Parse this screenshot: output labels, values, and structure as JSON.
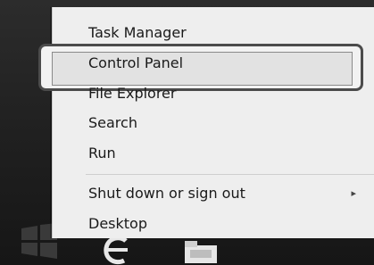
{
  "menu": {
    "items": [
      {
        "label": "Task Manager"
      },
      {
        "label": "Control Panel"
      },
      {
        "label": "File Explorer"
      },
      {
        "label": "Search"
      },
      {
        "label": "Run"
      },
      {
        "label": "Shut down or sign out"
      },
      {
        "label": "Desktop"
      }
    ],
    "submenu_arrow": "▸",
    "highlighted_item": "Control Panel"
  },
  "taskbar": {
    "icons": [
      "windows-logo-icon",
      "internet-explorer-icon",
      "file-explorer-icon"
    ]
  },
  "colors": {
    "menu_bg": "#eeeeee",
    "taskbar_bg": "#1f1f1f",
    "highlight_border": "#4b4b4b"
  }
}
